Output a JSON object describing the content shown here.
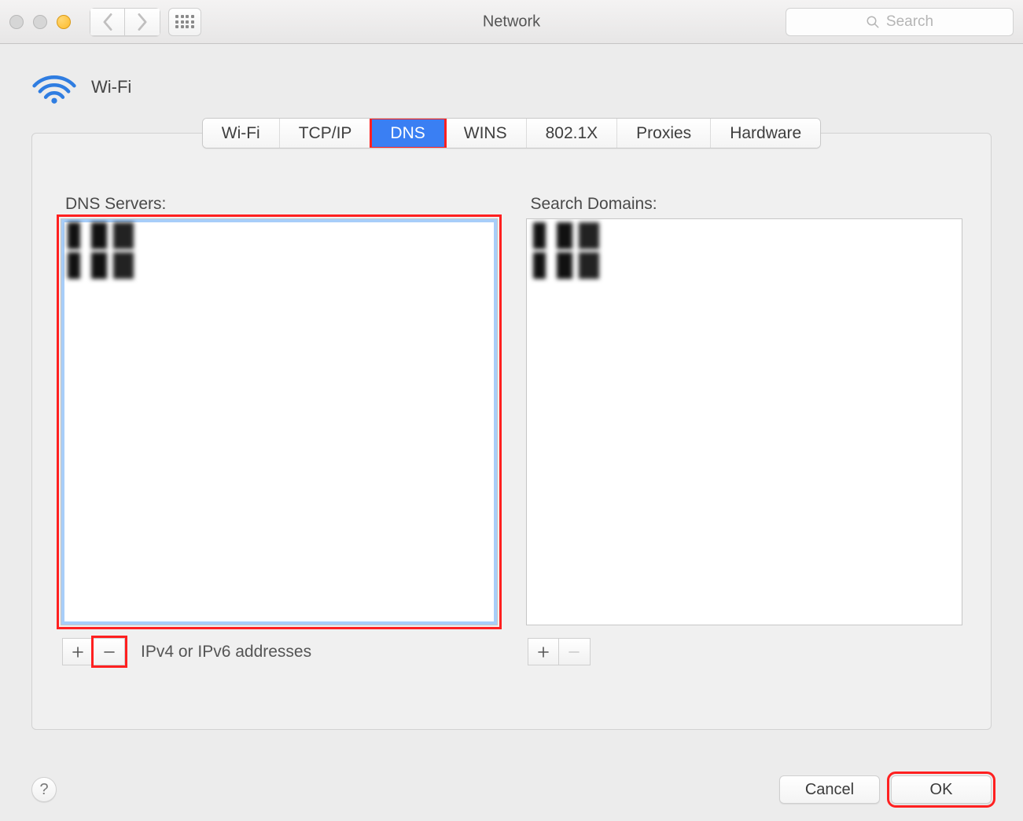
{
  "window": {
    "title": "Network"
  },
  "search": {
    "placeholder": "Search"
  },
  "header": {
    "interface_label": "Wi-Fi"
  },
  "tabs": [
    {
      "label": "Wi-Fi"
    },
    {
      "label": "TCP/IP"
    },
    {
      "label": "DNS"
    },
    {
      "label": "WINS"
    },
    {
      "label": "802.1X"
    },
    {
      "label": "Proxies"
    },
    {
      "label": "Hardware"
    }
  ],
  "dns": {
    "label": "DNS Servers:",
    "hint": "IPv4 or IPv6 addresses"
  },
  "search_domains": {
    "label": "Search Domains:"
  },
  "buttons": {
    "cancel": "Cancel",
    "ok": "OK",
    "help": "?"
  }
}
